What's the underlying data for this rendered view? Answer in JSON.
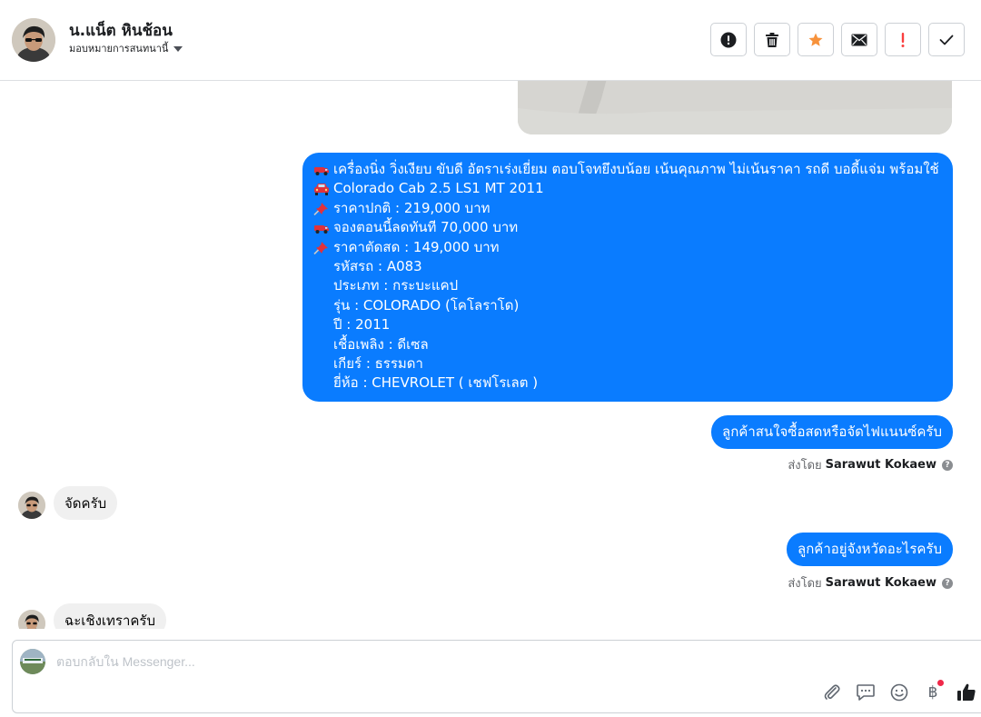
{
  "header": {
    "contact_name": "น.แน็ต หินช้อน",
    "assign_label": "มอบหมายการสนทนานี้",
    "actions": [
      {
        "name": "report-spam",
        "icon": "alert-circle-icon"
      },
      {
        "name": "delete",
        "icon": "trash-icon"
      },
      {
        "name": "star",
        "icon": "star-icon",
        "color": "#f7923b"
      },
      {
        "name": "mark-unread",
        "icon": "envelope-icon"
      },
      {
        "name": "follow-up",
        "icon": "exclamation-icon",
        "color": "#fa3e3e"
      },
      {
        "name": "mark-done",
        "icon": "checkmark-icon"
      }
    ]
  },
  "thread": {
    "listing_message": {
      "lines": [
        {
          "emoji": "red-truck-icon",
          "text": "เครื่องนิ่ง วิ่งเงียบ ขับดี อัตราเร่งเยี่ยม ตอบโจทยึงบน้อย เน้นคุณภาพ ไม่เน้นราคา รถดี บอดี้แจ่ม พร้อมใช้"
        },
        {
          "emoji": "red-car-icon",
          "text": "Colorado Cab 2.5 LS1 MT 2011"
        },
        {
          "emoji": "pushpin-icon",
          "text": "ราคาปกติ : 219,000 บาท"
        },
        {
          "emoji": "red-truck-icon",
          "text": "จองตอนนี้ลดทันที 70,000 บาท"
        },
        {
          "emoji": "pushpin-icon",
          "text": "ราคาตัดสด : 149,000 บาท"
        },
        {
          "emoji": "",
          "text": "รหัสรถ : A083"
        },
        {
          "emoji": "",
          "text": "ประเภท : กระบะแคป"
        },
        {
          "emoji": "",
          "text": "รุ่น : COLORADO (โคโลราโด)"
        },
        {
          "emoji": "",
          "text": "ปี : 2011"
        },
        {
          "emoji": "",
          "text": "เชื้อเพลิง : ดีเซล"
        },
        {
          "emoji": "",
          "text": "เกียร์ : ธรรมดา"
        },
        {
          "emoji": "",
          "text": "ยี่ห้อ : CHEVROLET ( เชฟโรเลต )"
        }
      ]
    },
    "out_message_1": "ลูกค้าสนใจซื้อสดหรือจัดไฟแนนซ์ครับ",
    "sent_by_prefix": "ส่งโดย",
    "sent_by_name": "Sarawut Kokaew",
    "in_message_1": "จัดครับ",
    "out_message_2": "ลูกค้าอยู่จังหวัดอะไรครับ",
    "in_message_2": "ฉะเชิงเทราครับ"
  },
  "composer": {
    "placeholder": "ตอบกลับใน Messenger...",
    "icons": [
      "paperclip-icon",
      "saved-reply-icon",
      "smiley-icon",
      "baht-payment-icon",
      "thumbs-up-icon"
    ],
    "baht_symbol": "฿"
  },
  "colors": {
    "outgoing_bubble": "#0a7cff",
    "incoming_bubble": "#f0f0f0",
    "border": "#ccd0d5"
  }
}
